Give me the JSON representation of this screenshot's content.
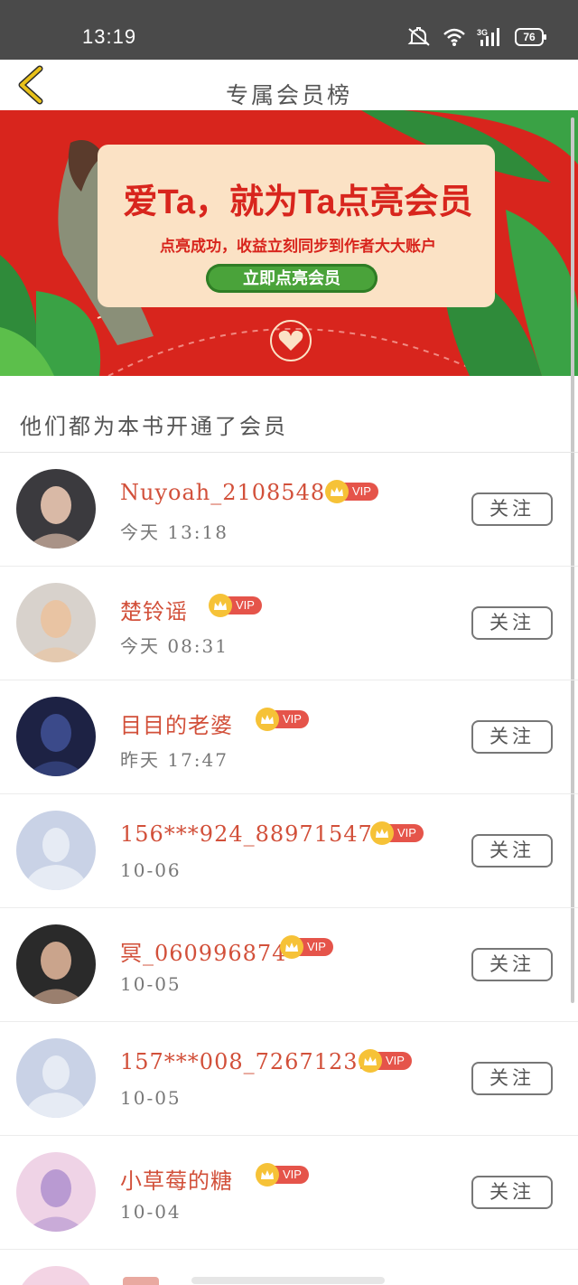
{
  "status_bar": {
    "time": "13:19",
    "battery": "76",
    "network": "3G"
  },
  "nav": {
    "title": "专属会员榜",
    "back_icon": "chevron-left-icon"
  },
  "banner": {
    "headline": "爱Ta，就为Ta点亮会员",
    "subline": "点亮成功，收益立刻同步到作者大大账户",
    "cta": "立即点亮会员"
  },
  "section": {
    "heading": "他们都为本书开通了会员"
  },
  "members": [
    {
      "name": "Nuyoah_210854868",
      "time": "今天  13:18",
      "vip": "VIP",
      "follow": "关注",
      "avatar": "photo"
    },
    {
      "name": "楚铃谣",
      "time": "今天  08:31",
      "vip": "VIP",
      "follow": "关注",
      "avatar": "photo"
    },
    {
      "name": "目目的老婆",
      "time": "昨天  17:47",
      "vip": "VIP",
      "follow": "关注",
      "avatar": "photo"
    },
    {
      "name": "156***924_8897154766",
      "time": "10-06",
      "vip": "VIP",
      "follow": "关注",
      "avatar": "default"
    },
    {
      "name": "冥_060996874",
      "time": "10-05",
      "vip": "VIP",
      "follow": "关注",
      "avatar": "photo"
    },
    {
      "name": "157***008_726712395",
      "time": "10-05",
      "vip": "VIP",
      "follow": "关注",
      "avatar": "default"
    },
    {
      "name": "小草莓的糖",
      "time": "10-04",
      "vip": "VIP",
      "follow": "关注",
      "avatar": "photo"
    }
  ],
  "colors": {
    "accent_red": "#d8251d",
    "name_red": "#d2503a",
    "vip_gold": "#f6c237",
    "vip_red": "#e5544a",
    "back_yellow": "#e8c11a"
  }
}
